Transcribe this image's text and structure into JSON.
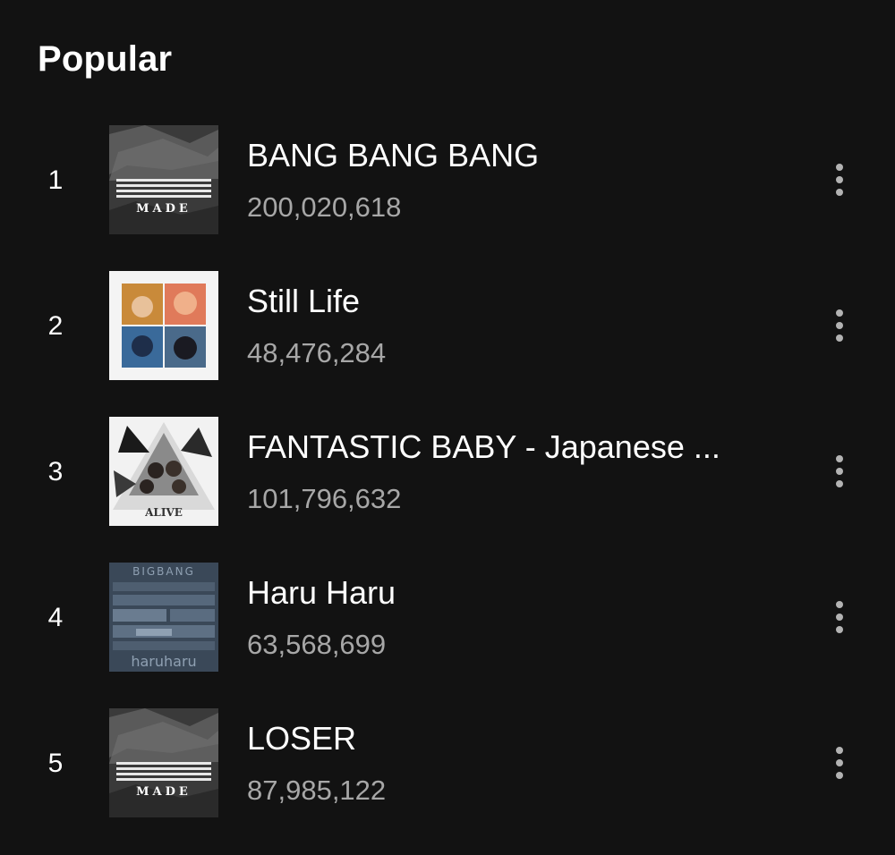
{
  "section": {
    "title": "Popular"
  },
  "colors": {
    "background": "#121212",
    "title_text": "#ffffff",
    "secondary_text": "#a7a7a7",
    "icon": "#b3b3b3"
  },
  "tracks": [
    {
      "rank": "1",
      "title": "BANG BANG BANG",
      "plays": "200,020,618",
      "cover": {
        "art_text": "MADE",
        "style": "made"
      },
      "menu_icon": "more-vertical-icon"
    },
    {
      "rank": "2",
      "title": "Still Life",
      "plays": "48,476,284",
      "cover": {
        "style": "still-life"
      },
      "menu_icon": "more-vertical-icon"
    },
    {
      "rank": "3",
      "title": "FANTASTIC BABY - Japanese ...",
      "plays": "101,796,632",
      "cover": {
        "art_text": "ALIVE",
        "style": "alive"
      },
      "menu_icon": "more-vertical-icon"
    },
    {
      "rank": "4",
      "title": "Haru Haru",
      "plays": "63,568,699",
      "cover": {
        "art_text_top": "BIGBANG",
        "art_text_bottom": "haruharu",
        "style": "haruharu"
      },
      "menu_icon": "more-vertical-icon"
    },
    {
      "rank": "5",
      "title": "LOSER",
      "plays": "87,985,122",
      "cover": {
        "art_text": "MADE",
        "style": "made"
      },
      "menu_icon": "more-vertical-icon"
    }
  ]
}
